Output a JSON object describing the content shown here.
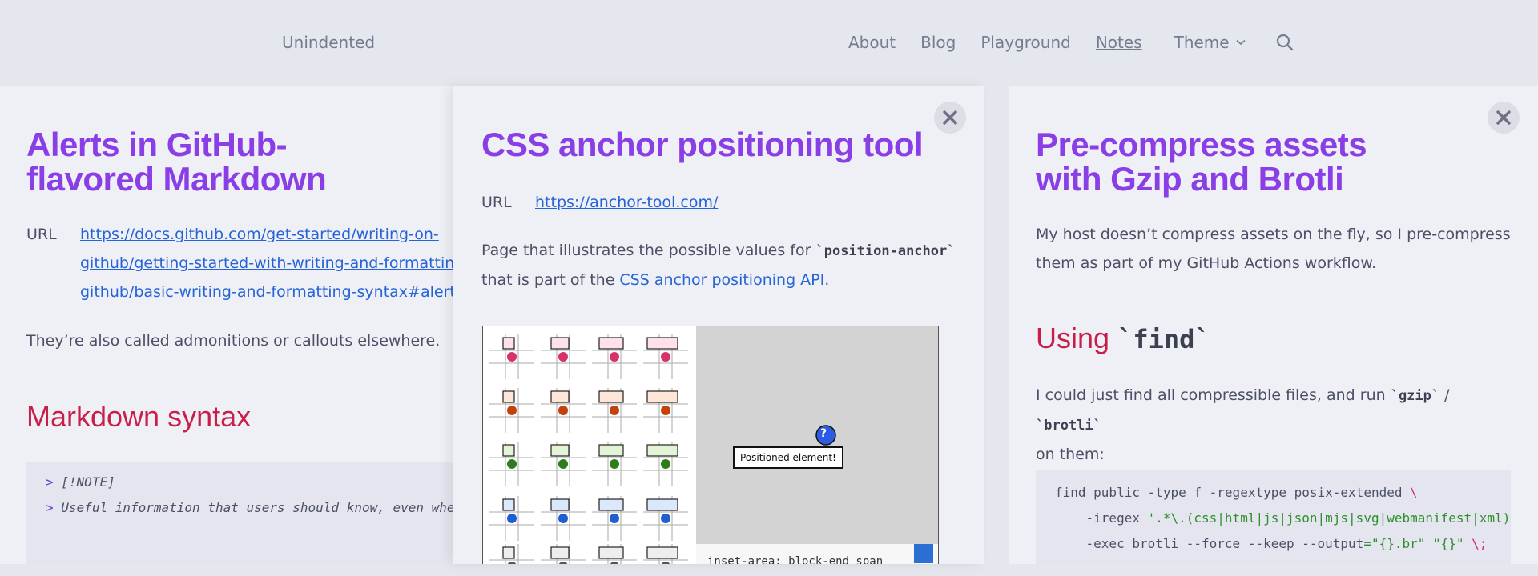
{
  "site": {
    "brand": "Unindented",
    "nav": [
      {
        "label": "About"
      },
      {
        "label": "Blog"
      },
      {
        "label": "Playground"
      },
      {
        "label": "Notes",
        "current": true
      }
    ],
    "theme_label": "Theme"
  },
  "panel1": {
    "title_line1": "Alerts in GitHub-",
    "title_line2": "flavored Markdown",
    "url_label": "URL",
    "url_line1": "https://docs.github.com/get-started/writing-on-",
    "url_line2": "github/getting-started-with-writing-and-formatting-on-",
    "url_line3": "github/basic-writing-and-formatting-syntax#alerts",
    "intro": "They’re also called admonitions or callouts elsewhere.",
    "section_heading": "Markdown syntax",
    "code_line1_marker": ">",
    "code_line1_text": "[!NOTE]",
    "code_line2_marker": ">",
    "code_line2_text": "Useful information that users should know, even whe"
  },
  "panel2": {
    "title": "CSS anchor positioning tool",
    "url_label": "URL",
    "url": "https://anchor-tool.com/",
    "desc_part1": "Page that illustrates the possible values for ",
    "desc_code": "`position-anchor`",
    "desc_part2": "that is part of the ",
    "desc_link": "CSS anchor positioning API",
    "desc_end": ".",
    "demo_label": "Positioned element!",
    "demo_badge": "?",
    "demo_code": "inset-area: block-end span"
  },
  "panel3": {
    "title_line1": "Pre-compress assets",
    "title_line2": "with Gzip and Brotli",
    "intro_line1": "My host doesn’t compress assets on the fly, so I pre-compress",
    "intro_line2": "them as part of my GitHub Actions workflow.",
    "heading_prefix": "Using ",
    "heading_code": "`find`",
    "text_part1": "I could just find all compressible files, and run ",
    "text_code1": "`gzip`",
    "text_sep": " / ",
    "text_code2": "`brotli`",
    "text_part2": "on them:",
    "cmd_line1": "find public -type f -regextype posix-extended ",
    "cmd_line1_bs": "\\",
    "cmd_line2_a": "    -iregex ",
    "cmd_line2_str": "'.*\\.(css|html|js|json|mjs|svg|webmanifest|xml)",
    "cmd_line3_a": "    -exec brotli --force --keep --output",
    "cmd_line3_str1": "=\"{}.br\"",
    "cmd_line3_str2": " \"{}\"",
    "cmd_line3_bs": " \\;"
  },
  "colors": {
    "title": "#8a3ee6",
    "heading": "#c81e4a",
    "link": "#2563d9"
  },
  "icons": {
    "close": "close-icon",
    "search": "search-icon",
    "chevron": "chevron-down-icon"
  }
}
